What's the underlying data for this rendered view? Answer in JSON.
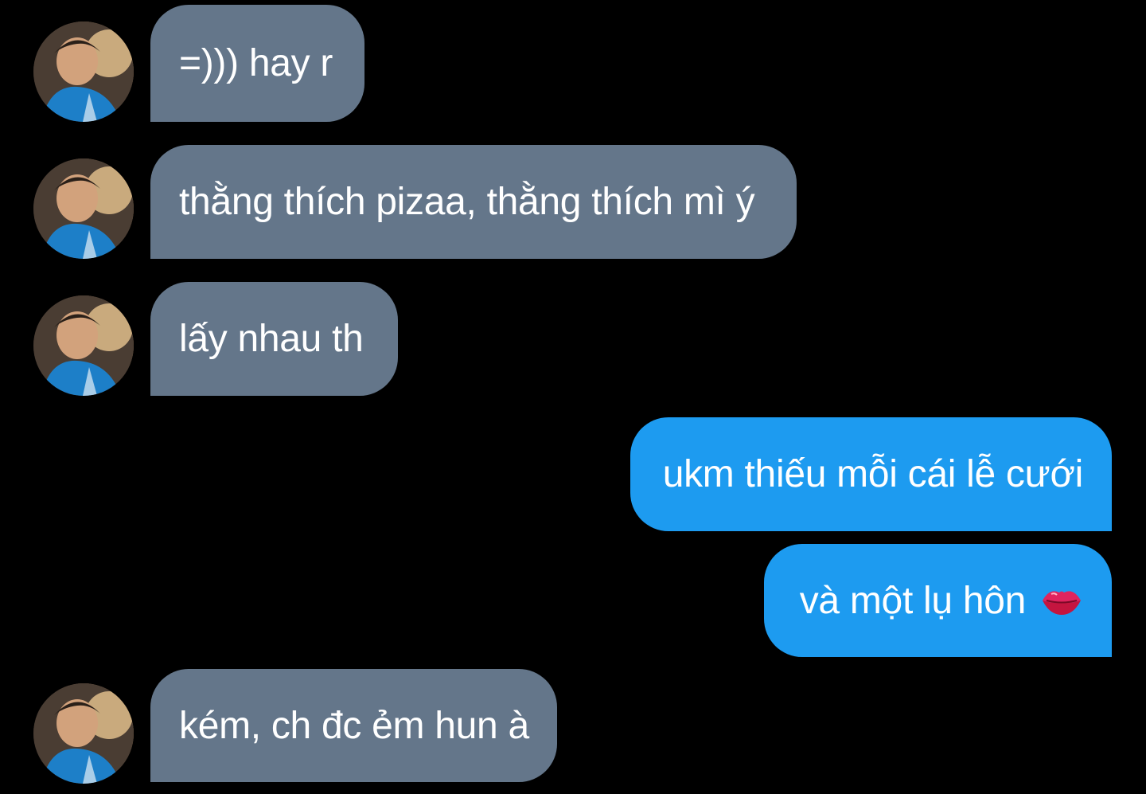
{
  "colors": {
    "background": "#000000",
    "incoming_bubble": "#64768a",
    "outgoing_bubble": "#1d9bf0",
    "text": "#ffffff"
  },
  "contact": {
    "avatar": "avatar-photo"
  },
  "messages": [
    {
      "direction": "incoming",
      "text": "=))) hay r"
    },
    {
      "direction": "incoming",
      "text": "thằng thích pizaa, thằng thích mì ý"
    },
    {
      "direction": "incoming",
      "text": "lấy nhau th"
    },
    {
      "direction": "outgoing",
      "text": "ukm thiếu mỗi cái lễ cưới"
    },
    {
      "direction": "outgoing",
      "text": "và một lụ hôn",
      "emoji": "kiss-mark-emoji"
    },
    {
      "direction": "incoming",
      "text": "kém, ch đc ẻm hun à"
    }
  ]
}
